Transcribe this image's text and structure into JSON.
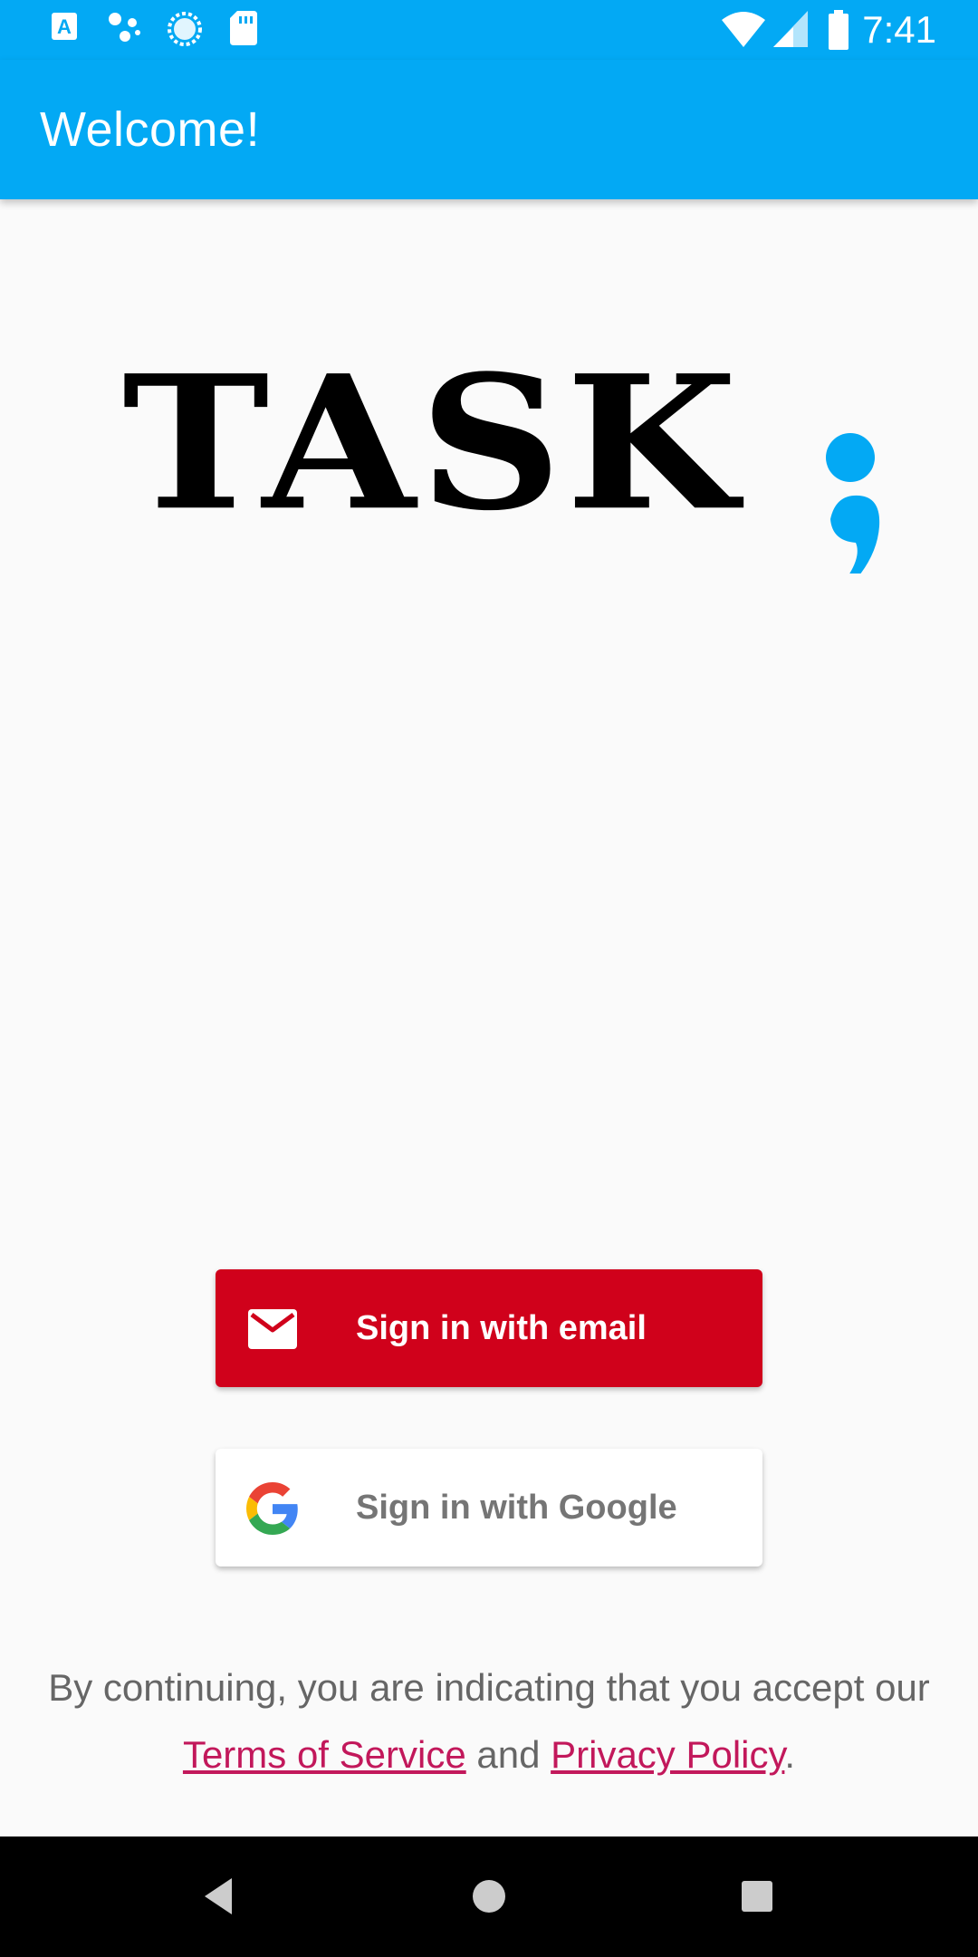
{
  "status_bar": {
    "time": "7:41",
    "icons": [
      "keyboard-a-icon",
      "assistant-dots-icon",
      "sync-icon",
      "sd-card-icon",
      "wifi-icon",
      "cell-signal-icon",
      "battery-icon"
    ]
  },
  "app_bar": {
    "title": "Welcome!"
  },
  "logo": {
    "text": "TASK",
    "punctuation": ";",
    "accent_color": "#03a9f4"
  },
  "buttons": {
    "email": {
      "label": "Sign in with email",
      "icon": "mail-icon",
      "color": "#d0011b"
    },
    "google": {
      "label": "Sign in with Google",
      "icon": "google-icon",
      "color": "#ffffff"
    }
  },
  "legal": {
    "prefix": "By continuing, you are indicating that you accept our",
    "terms_link": "Terms of Service",
    "connector": "and",
    "privacy_link": "Privacy Policy",
    "suffix": ".",
    "link_color": "#c2185b"
  },
  "nav_bar": {
    "items": [
      "back-icon",
      "home-icon",
      "recents-icon"
    ]
  },
  "colors": {
    "primary": "#03a9f4",
    "background": "#fafafa"
  }
}
